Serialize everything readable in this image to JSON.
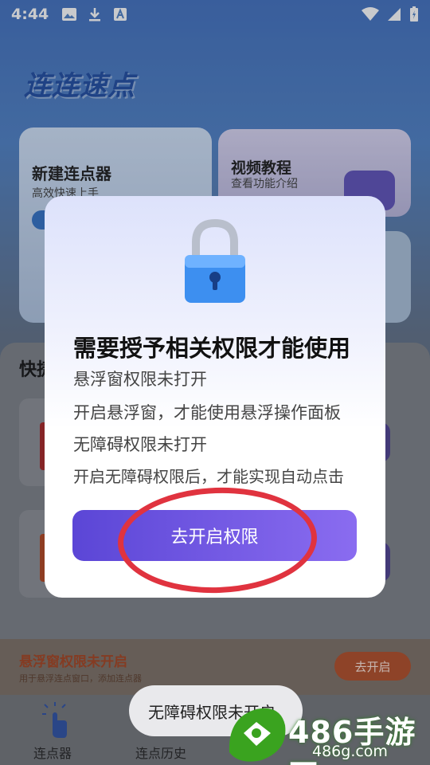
{
  "status_bar": {
    "time": "4:44"
  },
  "app": {
    "logo": "连连速点",
    "card_new": {
      "title": "新建连点器",
      "subtitle": "高效快速上手"
    },
    "card_video": {
      "title": "视频教程",
      "subtitle": "查看功能介绍"
    },
    "section_title": "快捷",
    "permission_bar": {
      "title": "悬浮窗权限未开启",
      "subtitle": "用于悬浮连点窗口，添加连点器",
      "button": "去开启"
    },
    "nav": [
      {
        "label": "连点器"
      },
      {
        "label": "连点历史"
      }
    ]
  },
  "dialog": {
    "title": "需要授予相关权限才能使用",
    "lines": [
      "悬浮窗权限未打开",
      "开启悬浮窗，才能使用悬浮操作面板",
      "无障碍权限未打开",
      "开启无障碍权限后，才能实现自动点击"
    ],
    "button": "去开启权限"
  },
  "toast": "无障碍权限未开启",
  "watermark": {
    "brand": "486手游网",
    "url": "486g.com"
  },
  "colors": {
    "button_gradient_start": "#5b46d6",
    "button_gradient_end": "#8a6cf0",
    "annotation_ring": "#e0333f"
  }
}
